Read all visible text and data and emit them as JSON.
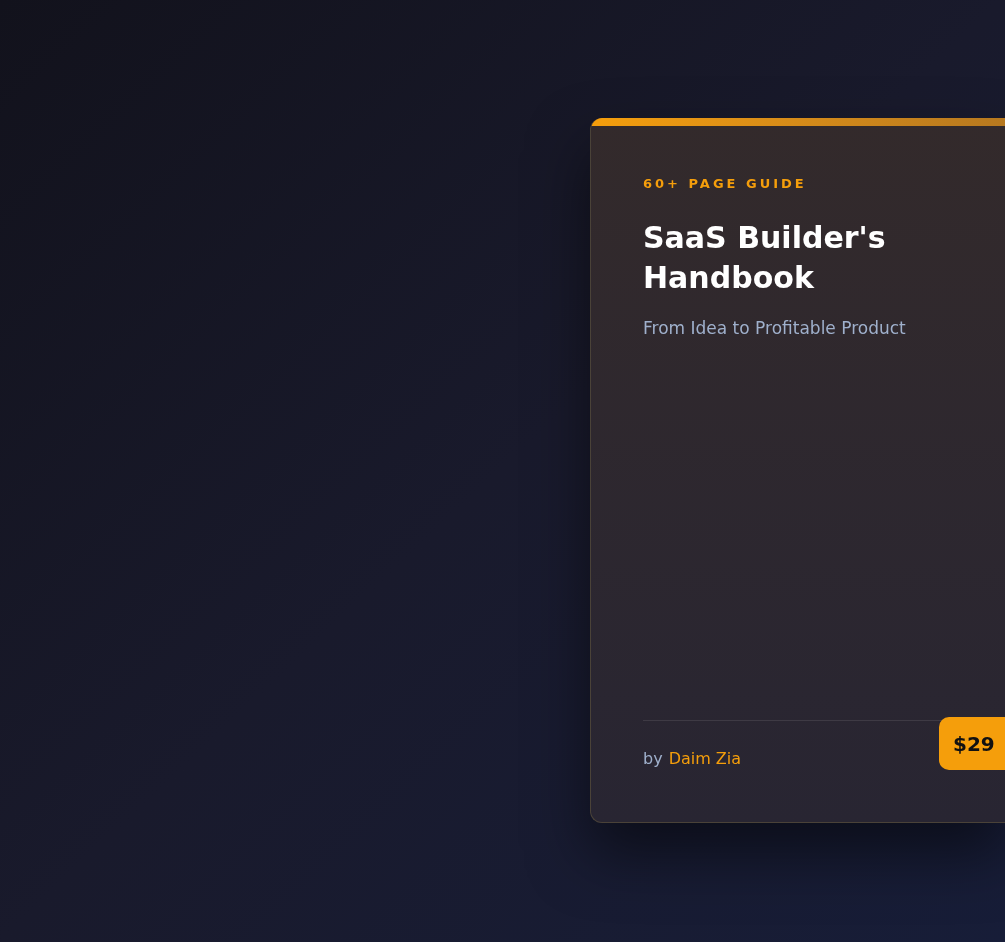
{
  "card": {
    "eyebrow": "60+ PAGE GUIDE",
    "title": "SaaS Builder's Handbook",
    "subtitle": "From Idea to Profitable Product",
    "byline_prefix": "by",
    "author": "Daim Zia",
    "price": "$29"
  }
}
